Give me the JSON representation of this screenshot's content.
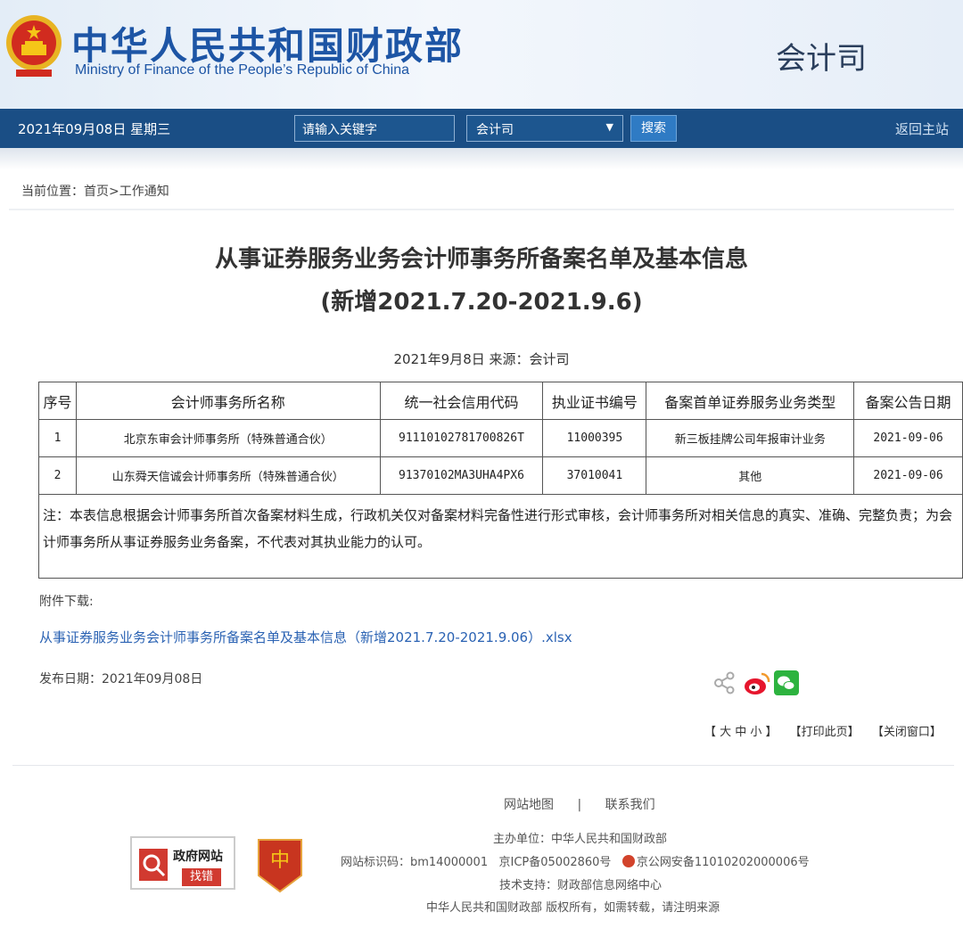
{
  "header": {
    "site_title_cn": "中华人民共和国财政部",
    "site_title_en": "Ministry of Finance of the People’s Republic of China",
    "dept_name": "会计司"
  },
  "nav": {
    "date": "2021年09月08日  星期三",
    "search_placeholder": "请输入关键字",
    "select_value": "会计司",
    "search_button": "搜索",
    "home_link": "返回主站"
  },
  "breadcrumb": "当前位置：首页>工作通知",
  "article": {
    "title_line1": "从事证券服务业务会计师事务所备案名单及基本信息",
    "title_line2": "(新增2021.7.20-2021.9.6)",
    "meta": "2021年9月8日 来源：会计司"
  },
  "table": {
    "headers": [
      "序号",
      "会计师事务所名称",
      "统一社会信用代码",
      "执业证书编号",
      "备案首单证券服务业务类型",
      "备案公告日期"
    ],
    "rows": [
      [
        "1",
        "北京东审会计师事务所（特殊普通合伙）",
        "91110102781700826T",
        "11000395",
        "新三板挂牌公司年报审计业务",
        "2021-09-06"
      ],
      [
        "2",
        "山东舜天信诚会计师事务所（特殊普通合伙）",
        "91370102MA3UHA4PX6",
        "37010041",
        "其他",
        "2021-09-06"
      ]
    ],
    "note": "注：本表信息根据会计师事务所首次备案材料生成，行政机关仅对备案材料完备性进行形式审核，会计师事务所对相关信息的真实、准确、完整负责；为会计师事务所从事证券服务业务备案，不代表对其执业能力的认可。"
  },
  "attachment": {
    "label": "附件下载:",
    "link": "从事证券服务业务会计师事务所备案名单及基本信息（新增2021.7.20-2021.9.06）.xlsx"
  },
  "pubdate": "发布日期：2021年09月08日",
  "toolbar": {
    "font_size": "【 大 中 小 】",
    "print": "【打印此页】",
    "close": "【关闭窗口】"
  },
  "footer": {
    "sitemap": "网站地图",
    "separator": "|",
    "contact": "联系我们",
    "host": "主办单位：中华人民共和国财政部",
    "site_id": "网站标识码：bm14000001",
    "icp": "京ICP备05002860号",
    "police": "京公网安备11010202000006号",
    "tech": "技术支持：财政部信息网络中心",
    "copyright": "中华人民共和国财政部  版权所有，如需转载，请注明来源",
    "gov_badge_top": "政府网站",
    "gov_badge_bottom": "找错"
  },
  "colors": {
    "nav_bg": "#1a4e85",
    "title_blue": "#1d55a5",
    "link_blue": "#2a62b3"
  }
}
